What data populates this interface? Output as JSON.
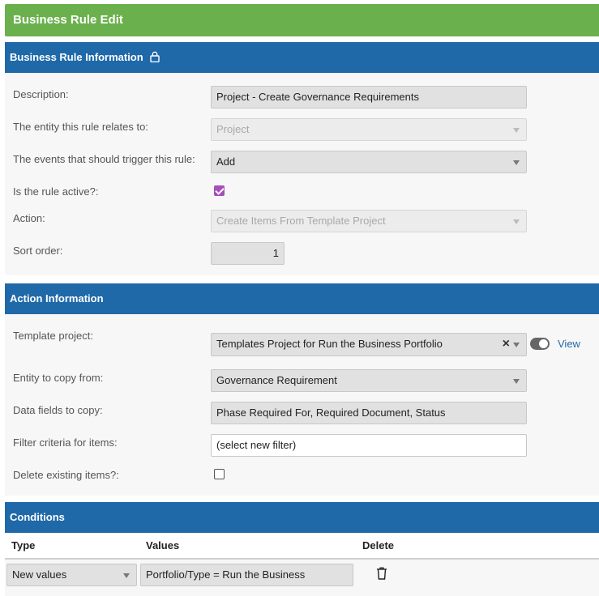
{
  "title_bar": {
    "title": "Business Rule  Edit"
  },
  "rule_info": {
    "header": "Business Rule Information",
    "description_label": "Description:",
    "description_value": "Project - Create Governance Requirements",
    "entity_label": "The entity this rule relates to:",
    "entity_value": "Project",
    "events_label": "The events that should trigger this rule:",
    "events_value": "Add",
    "active_label": "Is the rule active?:",
    "active_checked": true,
    "action_label": "Action:",
    "action_value": "Create Items From Template Project",
    "sort_label": "Sort order:",
    "sort_value": "1"
  },
  "action_info": {
    "header": "Action Information",
    "template_label": "Template project:",
    "template_value": "Templates Project for Run the Business Portfolio",
    "clear_symbol": "×",
    "view_link": "View",
    "entity_copy_label": "Entity to copy from:",
    "entity_copy_value": "Governance Requirement",
    "fields_label": "Data fields to copy:",
    "fields_value": "Phase Required For, Required Document, Status",
    "filter_label": "Filter criteria for items:",
    "filter_value": "(select new filter)",
    "delete_label": "Delete existing items?:",
    "delete_checked": false
  },
  "conditions": {
    "header": "Conditions",
    "columns": [
      "Type",
      "Values",
      "Delete"
    ],
    "rows": [
      {
        "type": "New values",
        "value": "Portfolio/Type =  Run the Business"
      }
    ]
  },
  "colors": {
    "title_green": "#6ab04c",
    "header_blue": "#1f69a9",
    "checkbox_purple": "#a64fb8"
  }
}
